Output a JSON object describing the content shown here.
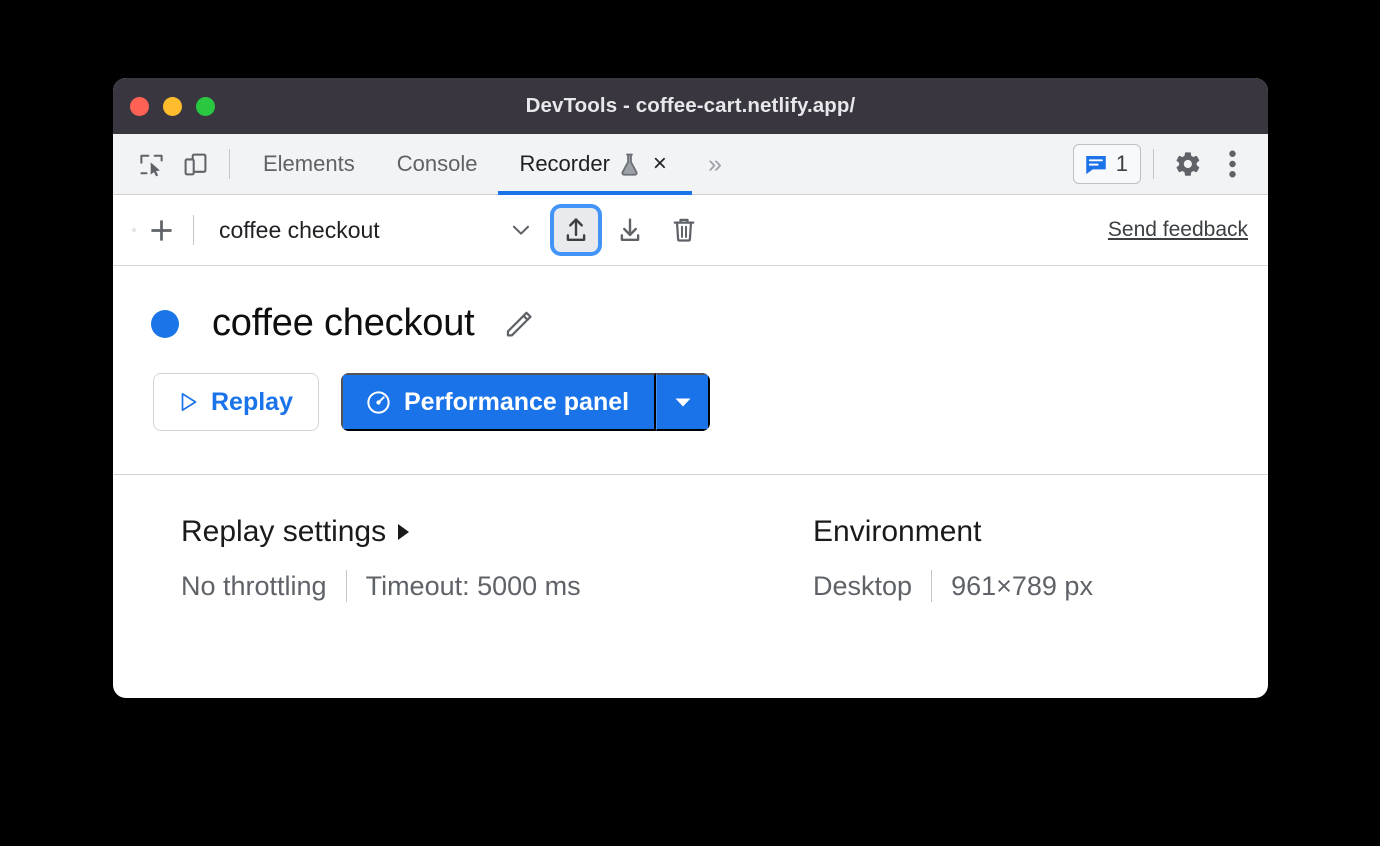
{
  "window": {
    "title": "DevTools - coffee-cart.netlify.app/",
    "traffic_lights": [
      "close",
      "minimize",
      "maximize"
    ],
    "colors": {
      "titlebar_bg": "#393640",
      "close": "#ff6155",
      "minimize": "#ffbd2e",
      "maximize": "#2ac840",
      "accent_blue": "#1a73e8",
      "focus_ring": "#4294f7",
      "tabbar_bg": "#f1f3f4"
    }
  },
  "tabbar": {
    "left_icons": [
      {
        "name": "inspect-element-icon",
        "label": "Inspect element"
      },
      {
        "name": "device-toolbar-icon",
        "label": "Toggle device toolbar"
      }
    ],
    "tabs": [
      {
        "label": "Elements",
        "active": false
      },
      {
        "label": "Console",
        "active": false
      },
      {
        "label": "Recorder",
        "active": true,
        "experimental": true,
        "closable": true
      }
    ],
    "close_glyph": "×",
    "more_tabs_glyph": "»",
    "issues_count": "1",
    "right_icons": [
      {
        "name": "settings-gear-icon",
        "label": "Settings"
      },
      {
        "name": "more-options-icon",
        "label": "Customize and control DevTools"
      }
    ]
  },
  "recorder_toolbar": {
    "add_recording_label": "Add recording",
    "selected_recording": "coffee checkout",
    "buttons": [
      {
        "name": "export-button",
        "label": "Export recording",
        "focused": true
      },
      {
        "name": "import-button",
        "label": "Import recording",
        "focused": false
      },
      {
        "name": "delete-button",
        "label": "Delete recording",
        "focused": false
      }
    ],
    "send_feedback_label": "Send feedback"
  },
  "recording": {
    "name": "coffee checkout",
    "edit_label": "Edit title",
    "status_color": "#1b74e8",
    "replay_button": "Replay",
    "performance_button": "Performance panel",
    "performance_dropdown_label": "More replay options"
  },
  "settings": {
    "replay": {
      "heading": "Replay settings",
      "throttling": "No throttling",
      "timeout": "Timeout: 5000 ms"
    },
    "environment": {
      "heading": "Environment",
      "device": "Desktop",
      "viewport": "961×789 px"
    }
  }
}
